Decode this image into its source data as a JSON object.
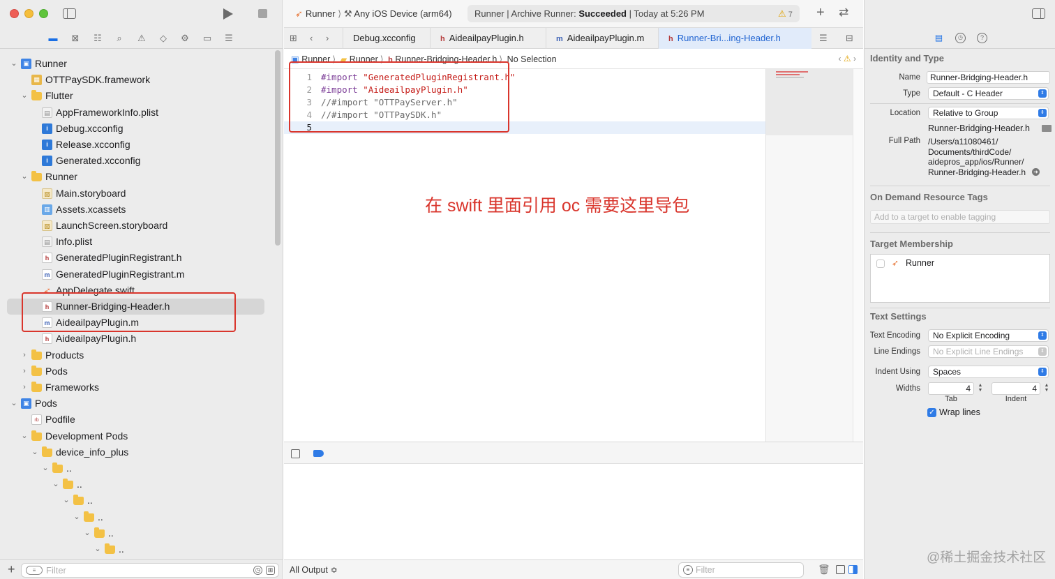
{
  "toolbar": {
    "scheme": "Runner",
    "destination": "Any iOS Device (arm64)",
    "status_prefix": "Runner | Archive Runner: ",
    "status_bold": "Succeeded",
    "status_suffix": " | Today at 5:26 PM",
    "warning_count": "7"
  },
  "tabs": [
    {
      "type": "",
      "label": "Debug.xcconfig"
    },
    {
      "type": "h",
      "label": "AideailpayPlugin.h"
    },
    {
      "type": "m",
      "label": "AideailpayPlugin.m"
    },
    {
      "type": "h",
      "label": "Runner-Bri...ing-Header.h"
    }
  ],
  "jumpbar": {
    "items": [
      "Runner",
      "Runner",
      "Runner-Bridging-Header.h",
      "No Selection"
    ]
  },
  "navigator": {
    "tree": [
      {
        "label": "Runner",
        "icon": "project-icon",
        "depth": 0,
        "chevron": "v"
      },
      {
        "label": "OTTPaySDK.framework",
        "icon": "framework-icon",
        "depth": 1,
        "chevron": ""
      },
      {
        "label": "Flutter",
        "icon": "folder-icon",
        "depth": 1,
        "chevron": "v"
      },
      {
        "label": "AppFrameworkInfo.plist",
        "icon": "plist-icon",
        "depth": 2,
        "chevron": ""
      },
      {
        "label": "Debug.xcconfig",
        "icon": "xcconfig-icon",
        "depth": 2,
        "chevron": ""
      },
      {
        "label": "Release.xcconfig",
        "icon": "xcconfig-icon",
        "depth": 2,
        "chevron": ""
      },
      {
        "label": "Generated.xcconfig",
        "icon": "xcconfig-icon",
        "depth": 2,
        "chevron": ""
      },
      {
        "label": "Runner",
        "icon": "folder-icon",
        "depth": 1,
        "chevron": "v"
      },
      {
        "label": "Main.storyboard",
        "icon": "storyboard-icon",
        "depth": 2,
        "chevron": ""
      },
      {
        "label": "Assets.xcassets",
        "icon": "assets-icon",
        "depth": 2,
        "chevron": ""
      },
      {
        "label": "LaunchScreen.storyboard",
        "icon": "storyboard-icon",
        "depth": 2,
        "chevron": ""
      },
      {
        "label": "Info.plist",
        "icon": "plist-icon",
        "depth": 2,
        "chevron": ""
      },
      {
        "label": "GeneratedPluginRegistrant.h",
        "icon": "header-file-icon",
        "depth": 2,
        "chevron": ""
      },
      {
        "label": "GeneratedPluginRegistrant.m",
        "icon": "objc-file-icon",
        "depth": 2,
        "chevron": ""
      },
      {
        "label": "AppDelegate.swift",
        "icon": "swift-file-icon",
        "depth": 2,
        "chevron": ""
      },
      {
        "label": "Runner-Bridging-Header.h",
        "icon": "header-file-icon",
        "depth": 2,
        "chevron": "",
        "selected": true
      },
      {
        "label": "AideailpayPlugin.m",
        "icon": "objc-file-icon",
        "depth": 2,
        "chevron": ""
      },
      {
        "label": "AideailpayPlugin.h",
        "icon": "header-file-icon",
        "depth": 2,
        "chevron": ""
      },
      {
        "label": "Products",
        "icon": "folder-icon",
        "depth": 1,
        "chevron": ">"
      },
      {
        "label": "Pods",
        "icon": "folder-icon",
        "depth": 1,
        "chevron": ">"
      },
      {
        "label": "Frameworks",
        "icon": "folder-icon",
        "depth": 1,
        "chevron": ">"
      },
      {
        "label": "Pods",
        "icon": "project-icon",
        "depth": 0,
        "chevron": "v"
      },
      {
        "label": "Podfile",
        "icon": "ruby-file-icon",
        "depth": 1,
        "chevron": ""
      },
      {
        "label": "Development Pods",
        "icon": "folder-icon",
        "depth": 1,
        "chevron": "v"
      },
      {
        "label": "device_info_plus",
        "icon": "folder-icon",
        "depth": 2,
        "chevron": "v"
      },
      {
        "label": "..",
        "icon": "folder-icon",
        "depth": 3,
        "chevron": "v"
      },
      {
        "label": "..",
        "icon": "folder-icon",
        "depth": 4,
        "chevron": "v"
      },
      {
        "label": "..",
        "icon": "folder-icon",
        "depth": 5,
        "chevron": "v"
      },
      {
        "label": "..",
        "icon": "folder-icon",
        "depth": 6,
        "chevron": "v"
      },
      {
        "label": "..",
        "icon": "folder-icon",
        "depth": 7,
        "chevron": "v"
      },
      {
        "label": "..",
        "icon": "folder-icon",
        "depth": 8,
        "chevron": "v"
      }
    ],
    "filter_placeholder": "Filter"
  },
  "editor": {
    "lines": [
      {
        "num": "1",
        "kw": "#import",
        "str": "\"GeneratedPluginRegistrant.h\"",
        "comment": ""
      },
      {
        "num": "2",
        "kw": "#import",
        "str": "\"AideailpayPlugin.h\"",
        "comment": ""
      },
      {
        "num": "3",
        "kw": "",
        "str": "",
        "comment": "//#import \"OTTPayServer.h\""
      },
      {
        "num": "4",
        "kw": "",
        "str": "",
        "comment": "//#import \"OTTPaySDK.h\""
      },
      {
        "num": "5",
        "kw": "",
        "str": "",
        "comment": ""
      }
    ],
    "annotation": "在 swift 里面引用 oc 需要这里导包"
  },
  "console": {
    "output_selector": "All Output ≎",
    "filter_placeholder": "Filter"
  },
  "inspector": {
    "identity_title": "Identity and Type",
    "name_label": "Name",
    "name_value": "Runner-Bridging-Header.h",
    "type_label": "Type",
    "type_value": "Default - C Header",
    "location_label": "Location",
    "location_value": "Relative to Group",
    "location_file": "Runner-Bridging-Header.h",
    "full_path_label": "Full Path",
    "full_path_lines": [
      "/Users/a11080461/",
      "Documents/thirdCode/",
      "aidepros_app/ios/Runner/",
      "Runner-Bridging-Header.h"
    ],
    "odr_title": "On Demand Resource Tags",
    "odr_placeholder": "Add to a target to enable tagging",
    "target_title": "Target Membership",
    "target_name": "Runner",
    "text_title": "Text Settings",
    "encoding_label": "Text Encoding",
    "encoding_value": "No Explicit Encoding",
    "line_endings_label": "Line Endings",
    "line_endings_value": "No Explicit Line Endings",
    "indent_label": "Indent Using",
    "indent_value": "Spaces",
    "widths_label": "Widths",
    "tab_width": "4",
    "indent_width": "4",
    "tab_sub": "Tab",
    "indent_sub": "Indent",
    "wrap_label": "Wrap lines"
  },
  "watermark": "@稀土掘金技术社区",
  "colors": {
    "accent": "#1a6fe5",
    "annotation": "#d9352c",
    "folder": "#f3c145"
  }
}
